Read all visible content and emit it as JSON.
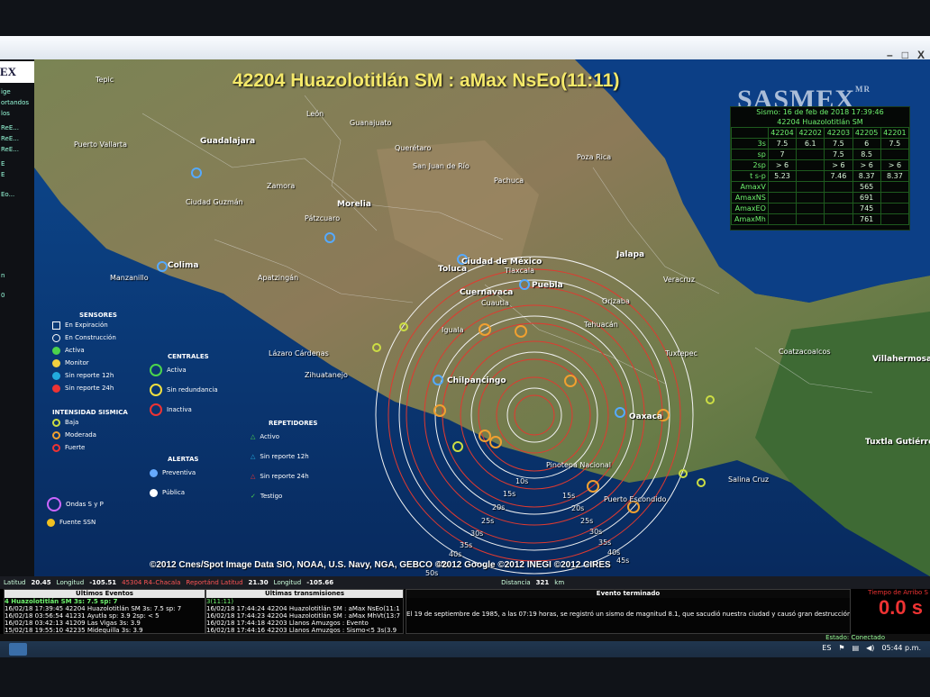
{
  "window": {
    "minimize": "–",
    "maximize": "□",
    "close": "X"
  },
  "sidebar": {
    "logo": "EX",
    "entries": [
      "ige",
      "ortandos",
      "los",
      "ReE...",
      "ReE...",
      "ReE...",
      "E",
      "E",
      "Eo...",
      "n",
      "0"
    ]
  },
  "map": {
    "title": "42204 Huazolotitlán SM : aMax NsEo(11:11)",
    "brand": "SASMEX",
    "brand_mark": "MR",
    "cities": [
      {
        "name": "Tepic",
        "big": false
      },
      {
        "name": "León",
        "big": false
      },
      {
        "name": "Guanajuato",
        "big": false
      },
      {
        "name": "Guadalajara",
        "big": true
      },
      {
        "name": "Puerto Vallarta",
        "big": false
      },
      {
        "name": "Querétaro",
        "big": false
      },
      {
        "name": "San Juan de Río",
        "big": false
      },
      {
        "name": "Pachuca",
        "big": false
      },
      {
        "name": "Poza Rica",
        "big": false
      },
      {
        "name": "Zamora",
        "big": false
      },
      {
        "name": "Morelia",
        "big": true
      },
      {
        "name": "Ciudad Guzmán",
        "big": false
      },
      {
        "name": "Colima",
        "big": true
      },
      {
        "name": "Pátzcuaro",
        "big": false
      },
      {
        "name": "Toluca",
        "big": true
      },
      {
        "name": "Ciudad de México",
        "big": true
      },
      {
        "name": "Tlaxcala",
        "big": false
      },
      {
        "name": "Puebla",
        "big": true
      },
      {
        "name": "Jalapa",
        "big": true
      },
      {
        "name": "Veracruz",
        "big": false
      },
      {
        "name": "Manzanillo",
        "big": false
      },
      {
        "name": "Apatzingán",
        "big": false
      },
      {
        "name": "Cuernavaca",
        "big": true
      },
      {
        "name": "Cuautla",
        "big": false
      },
      {
        "name": "Orizaba",
        "big": false
      },
      {
        "name": "Tehuacán",
        "big": false
      },
      {
        "name": "Iguala",
        "big": false
      },
      {
        "name": "Lázaro Cárdenas",
        "big": false
      },
      {
        "name": "Zihuatanejo",
        "big": false
      },
      {
        "name": "Tuxtepec",
        "big": false
      },
      {
        "name": "Coatzacoalcos",
        "big": false
      },
      {
        "name": "Villahermosa",
        "big": true
      },
      {
        "name": "Chilpancingo",
        "big": true
      },
      {
        "name": "Oaxaca",
        "big": true
      },
      {
        "name": "Pinotepa Nacional",
        "big": false
      },
      {
        "name": "Puerto Escondido",
        "big": false
      },
      {
        "name": "Salina Cruz",
        "big": false
      },
      {
        "name": "Tuxtla Gutiérrez",
        "big": true
      }
    ],
    "credits": "©2012 Cnes/Spot Image  Data SIO, NOAA, U.S. Navy, NGA, GEBCO  ©2012 Google  ©2012 INEGI  ©2012 CIRES",
    "ring_labels": [
      "10s",
      "15s",
      "20s",
      "25s",
      "30s",
      "35s",
      "40s",
      "45s",
      "50s",
      "15s",
      "20s",
      "25s",
      "30s",
      "35s",
      "40s",
      "45s"
    ]
  },
  "info_box": {
    "date": "Sismo: 16 de feb de 2018 17:39:46",
    "station": "42204 Huazolotitlán SM",
    "columns": [
      "42204",
      "42202",
      "42203",
      "42205",
      "42201"
    ],
    "rows": [
      {
        "label": "3s",
        "values": [
          "7.5",
          "6.1",
          "7.5",
          "6",
          "7.5"
        ]
      },
      {
        "label": "sp",
        "values": [
          "7",
          "",
          "7.5",
          "8.5",
          ""
        ]
      },
      {
        "label": "2sp",
        "values": [
          "> 6",
          "",
          "> 6",
          "> 6",
          "> 6"
        ]
      },
      {
        "label": "t s-p",
        "values": [
          "5.23",
          "",
          "7.46",
          "8.37",
          "8.37"
        ]
      },
      {
        "label": "AmaxV",
        "values": [
          "",
          "",
          "",
          "565",
          ""
        ]
      },
      {
        "label": "AmaxNS",
        "values": [
          "",
          "",
          "",
          "691",
          ""
        ]
      },
      {
        "label": "AmaxEO",
        "values": [
          "",
          "",
          "",
          "745",
          ""
        ]
      },
      {
        "label": "AmaxMh",
        "values": [
          "",
          "",
          "",
          "761",
          ""
        ]
      }
    ]
  },
  "legend": {
    "sensores": {
      "title": "SENSORES",
      "items": [
        "En Expiración",
        "En Construcción",
        "Activa",
        "Monitor",
        "Sin reporte 12h",
        "Sin reporte 24h"
      ]
    },
    "intensidad": {
      "title": "INTENSIDAD SISMICA",
      "items": [
        "Baja",
        "Moderada",
        "Fuerte"
      ]
    },
    "otros": [
      "Ondas S y P",
      "Fuente SSN"
    ],
    "centrales": {
      "title": "CENTRALES",
      "items": [
        "Activa",
        "Sin redundancia",
        "Inactiva"
      ]
    },
    "alertas": {
      "title": "ALERTAS",
      "items": [
        "Preventiva",
        "Pública"
      ]
    },
    "repetidores": {
      "title": "REPETIDORES",
      "items": [
        "Activo",
        "Sin reporte 12h",
        "Sin reporte 24h",
        "Testigo"
      ]
    }
  },
  "coords": {
    "lat_label": "Latitud",
    "lat": "20.45",
    "lon_label": "Longitud",
    "lon": "-105.51",
    "station": "45304 R4–Chacala",
    "reported_label": "Reportánd Latitud",
    "lat2": "21.30",
    "lon2_label": "Longitud",
    "lon2": "-105.66",
    "dist_label": "Distancia",
    "dist": "321",
    "dist_unit": "km"
  },
  "events_panel": {
    "title": "Últimos Eventos",
    "highlight": "4 Huazolotitlán SM 3s: 7.5 sp: 7",
    "lines": [
      "16/02/18 17:39:45 42204 Huazolotitlán SM 3s: 7.5 sp: 7",
      "16/02/18 03:56:54 41231 Ayutla sp: 3.9 2sp: < 5",
      "16/02/18 03:42:13 41209 Las Vigas 3s: 3.9",
      "15/02/18 19:55:10 42235 Midequilla 3s: 3.9",
      "14/02/18 07:46:43 42201 Llano Grande 3s: 3.9 sp: 3.9"
    ]
  },
  "trans_panel": {
    "title": "Últimas transmisiones",
    "prefix": "3(11:11)",
    "lines": [
      "16/02/18 17:44:24 42204 Huazolotitlán SM : aMax NsEo(11:1",
      "16/02/18 17:44:23 42204 Huazolotitlán SM : aMax MhVt(13:7",
      "16/02/18 17:44:18 42203 Llanos Amuzgos : Evento",
      "16/02/18 17:44:16 42203 Llanos Amuzgos : Sismo<5 3s(3.9",
      "16/02/18 17:44:11 42204 Huazolotitlán SM : Sismo<5 2SP(3"
    ]
  },
  "event_panel": {
    "title": "Evento terminado",
    "text": "El 19 de septiembre de 1985, a las 07:19 horas, se registró un sismo de magnitud 8.1, que sacudió nuestra ciudad y causó gran destrucción"
  },
  "timer": {
    "label": "Tiempo de Arribo S",
    "value": "0.0",
    "unit": "s"
  },
  "status": {
    "text": "Estado: Conectado"
  },
  "taskbar": {
    "lang": "ES",
    "time": "05:44 p.m."
  },
  "colors": {
    "title": "#f5e96a",
    "info_green": "#6ef26e",
    "ring_red": "#e03a30",
    "ring_white": "#f2f2f2",
    "sea": "#0c3a7c",
    "land": "#5c7a44"
  }
}
